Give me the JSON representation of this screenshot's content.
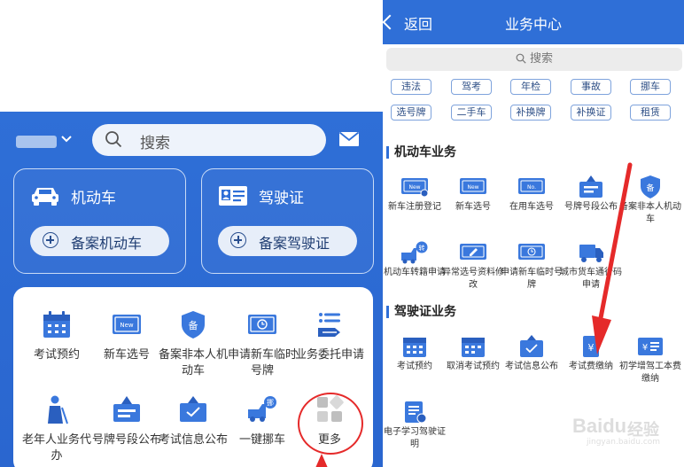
{
  "left": {
    "search_placeholder": "搜索",
    "cards": {
      "vehicle": {
        "title": "机动车",
        "button": "备案机动车"
      },
      "license": {
        "title": "驾驶证",
        "button": "备案驾驶证"
      }
    },
    "grid": [
      {
        "label": "考试预约",
        "icon": "calendar-icon"
      },
      {
        "label": "新车选号",
        "icon": "new-plate-icon"
      },
      {
        "label": "备案非本人机动车",
        "icon": "shield-icon"
      },
      {
        "label": "申请新车临时号牌",
        "icon": "temp-plate-icon"
      },
      {
        "label": "业务委托申请",
        "icon": "delegate-icon"
      },
      {
        "label": "老年人业务代办",
        "icon": "elderly-icon"
      },
      {
        "label": "号牌号段公布",
        "icon": "plate-segment-icon"
      },
      {
        "label": "考试信息公布",
        "icon": "exam-info-icon"
      },
      {
        "label": "一键挪车",
        "icon": "move-car-icon"
      },
      {
        "label": "更多",
        "icon": "more-grid-icon"
      }
    ]
  },
  "right": {
    "back_label": "返回",
    "title": "业务中心",
    "search_placeholder": "搜索",
    "tags_row1": [
      "违法",
      "驾考",
      "年检",
      "事故",
      "挪车"
    ],
    "tags_row2": [
      "选号牌",
      "二手车",
      "补换牌",
      "补换证",
      "租赁"
    ],
    "section_vehicle": "机动车业务",
    "vehicle_items": [
      {
        "label": "新车注册登记",
        "icon": "new-register-icon"
      },
      {
        "label": "新车选号",
        "icon": "new-plate-icon"
      },
      {
        "label": "在用车选号",
        "icon": "used-plate-icon"
      },
      {
        "label": "号牌号段公布",
        "icon": "plate-segment-icon"
      },
      {
        "label": "备案非本人机动车",
        "icon": "shield-icon"
      },
      {
        "label": "机动车转籍申请",
        "icon": "transfer-icon"
      },
      {
        "label": "异常选号资料修改",
        "icon": "edit-doc-icon"
      },
      {
        "label": "申请新车临时号牌",
        "icon": "temp-plate-icon"
      },
      {
        "label": "城市货车通行码申请",
        "icon": "truck-pass-icon"
      }
    ],
    "section_license": "驾驶证业务",
    "license_items": [
      {
        "label": "考试预约",
        "icon": "calendar-icon"
      },
      {
        "label": "取消考试预约",
        "icon": "cancel-calendar-icon"
      },
      {
        "label": "考试信息公布",
        "icon": "exam-info-icon"
      },
      {
        "label": "考试费缴纳",
        "icon": "fee-icon"
      },
      {
        "label": "初学增驾工本费缴纳",
        "icon": "fee-card-icon"
      },
      {
        "label": "电子学习驾驶证明",
        "icon": "e-certificate-icon"
      }
    ],
    "watermark": {
      "brand": "Baidu",
      "cn": "经验",
      "sub": "jingyan.baidu.com"
    }
  },
  "colors": {
    "primary": "#2f6fd7",
    "highlight": "#e52a2a"
  }
}
